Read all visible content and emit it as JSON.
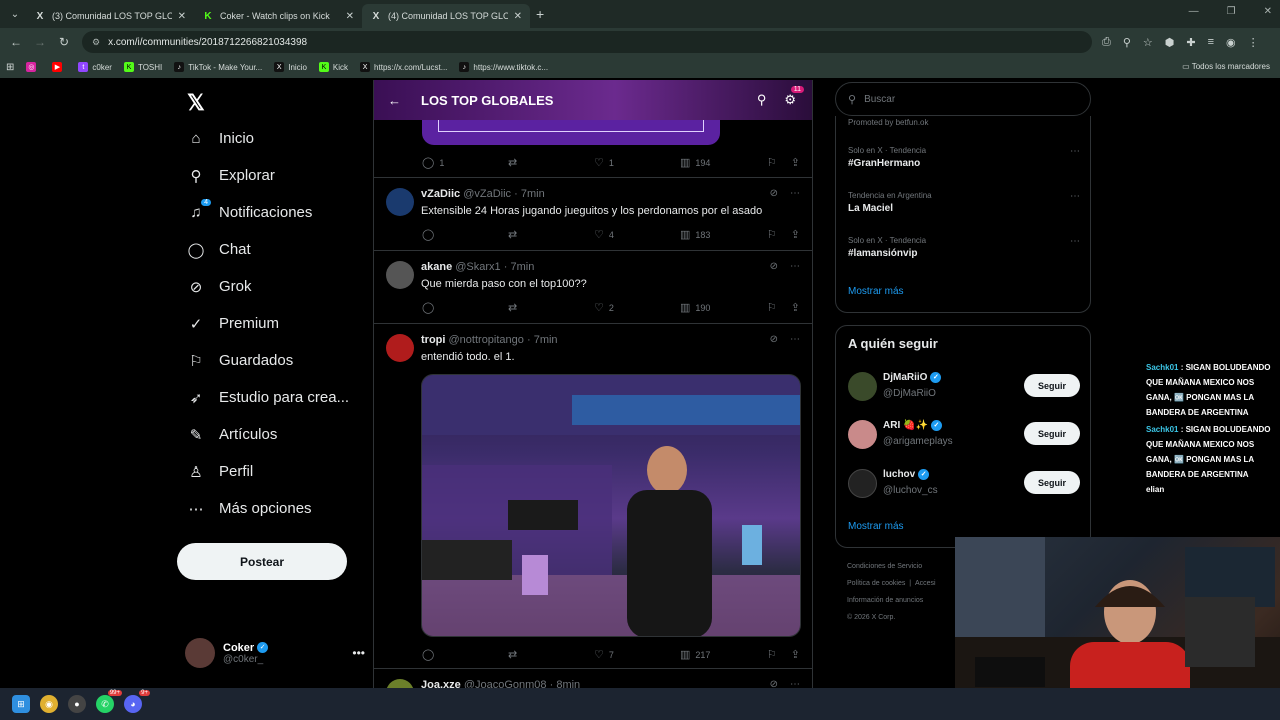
{
  "browser": {
    "tabs": [
      {
        "label": "(3) Comunidad LOS TOP GLOBALES",
        "icon": "x-logo-icon",
        "active": false
      },
      {
        "label": "Coker - Watch clips on Kick",
        "icon": "kick-icon",
        "active": false
      },
      {
        "label": "(4) Comunidad LOS TOP GLOBALES",
        "icon": "x-logo-icon",
        "active": true
      }
    ],
    "url": "x.com/i/communities/2018712266821034398",
    "bookmarks": [
      {
        "label": "",
        "icon": "instagram-icon",
        "color": "#d6249f"
      },
      {
        "label": "",
        "icon": "youtube-icon",
        "color": "#ff0000"
      },
      {
        "label": "c0ker",
        "icon": "twitch-icon",
        "color": "#9146ff"
      },
      {
        "label": "TOSHI",
        "icon": "kick-icon",
        "color": "#53fc18"
      },
      {
        "label": "TikTok - Make Your...",
        "icon": "tiktok-icon",
        "color": "#111111"
      },
      {
        "label": "Inicio",
        "icon": "x-logo-icon",
        "color": "#111111"
      },
      {
        "label": "Kick",
        "icon": "kick-icon",
        "color": "#53fc18"
      },
      {
        "label": "https://x.com/Lucst...",
        "icon": "x-logo-icon",
        "color": "#111111"
      },
      {
        "label": "https://www.tiktok.c...",
        "icon": "tiktok-icon",
        "color": "#111111"
      }
    ],
    "all_bookmarks": "Todos los marcadores"
  },
  "nav": {
    "items": [
      {
        "label": "Inicio",
        "icon": "home-icon",
        "glyph": "⌂"
      },
      {
        "label": "Explorar",
        "icon": "search-icon",
        "glyph": "⚲"
      },
      {
        "label": "Notificaciones",
        "icon": "bell-icon",
        "glyph": "🔔",
        "badge": "4"
      },
      {
        "label": "Chat",
        "icon": "chat-icon",
        "glyph": "◯"
      },
      {
        "label": "Grok",
        "icon": "grok-icon",
        "glyph": "⊘"
      },
      {
        "label": "Premium",
        "icon": "premium-icon",
        "glyph": "✓"
      },
      {
        "label": "Guardados",
        "icon": "bookmark-icon",
        "glyph": "⚐"
      },
      {
        "label": "Estudio para crea...",
        "icon": "rocket-icon",
        "glyph": "➶"
      },
      {
        "label": "Artículos",
        "icon": "article-icon",
        "glyph": "✎"
      },
      {
        "label": "Perfil",
        "icon": "profile-icon",
        "glyph": "♙"
      },
      {
        "label": "Más opciones",
        "icon": "more-icon",
        "glyph": "⋯"
      }
    ],
    "post_label": "Postear",
    "me": {
      "name": "Coker",
      "handle": "@c0ker_"
    }
  },
  "community": {
    "title": "LOS TOP GLOBALES",
    "settings_badge": "11"
  },
  "prev_tweet_actions": {
    "replies": "1",
    "likes": "1",
    "views": "194"
  },
  "tweets": [
    {
      "name": "vZaDiic",
      "handle": "@vZaDiic",
      "time": "7min",
      "text": "Extensible 24 Horas jugando jueguitos y los perdonamos por el asado",
      "replies": "",
      "likes": "4",
      "views": "183",
      "avatar_color": "#1a3a6e"
    },
    {
      "name": "akane",
      "handle": "@Skarx1",
      "time": "7min",
      "text": "Que mierda paso con el top100??",
      "replies": "",
      "likes": "2",
      "views": "190",
      "avatar_color": "#555555"
    },
    {
      "name": "tropi",
      "handle": "@nottropitango",
      "time": "7min",
      "text": "entendió todo. el 1.",
      "replies": "",
      "likes": "7",
      "views": "217",
      "avatar_color": "#b01c1c"
    },
    {
      "name": "Joa.xze",
      "handle": "@JoacoGonm08",
      "time": "8min",
      "text": "",
      "avatar_color": "#6b7f2a"
    }
  ],
  "search": {
    "placeholder": "Buscar"
  },
  "trends": {
    "promoted": "Promoted by betfun.ok",
    "items": [
      {
        "context": "Solo en X · Tendencia",
        "name": "#GranHermano"
      },
      {
        "context": "Tendencia en Argentina",
        "name": "La Maciel"
      },
      {
        "context": "Solo en X · Tendencia",
        "name": "#lamansiónvip"
      }
    ],
    "more": "Mostrar más"
  },
  "who_to_follow": {
    "title": "A quién seguir",
    "button": "Seguir",
    "items": [
      {
        "name": "DjMaRiiO",
        "handle": "@DjMaRiiO",
        "avatar_color": "#3a4a2a"
      },
      {
        "name": "ARI 🍓✨",
        "handle": "@arigameplays",
        "avatar_color": "#c98a8a"
      },
      {
        "name": "luchov",
        "handle": "@luchov_cs",
        "avatar_color": "#222222"
      }
    ],
    "more": "Mostrar más"
  },
  "footer": {
    "line1": "Condiciones de Servicio",
    "line2": "Política de cookies",
    "line2b": "Accesi",
    "line3": "Información de anuncios",
    "line4": "© 2026 X Corp."
  },
  "stream_chat": [
    {
      "user": "Sachk01",
      "msg": "SIGAN BOLUDEANDO QUE MAÑANA MEXICO NOS GANA, 🆗 PONGAN MAS LA BANDERA DE ARGENTINA"
    },
    {
      "user": "Sachk01",
      "msg": "SIGAN BOLUDEANDO QUE MAÑANA MEXICO NOS GANA, 🆗 PONGAN MAS LA BANDERA DE ARGENTINA"
    },
    {
      "user": "elian",
      "msg": ""
    }
  ],
  "taskbar": {
    "items": [
      {
        "icon": "windows-icon",
        "color": "#2f8fdf"
      },
      {
        "icon": "chrome-icon",
        "color": "#e0b030"
      },
      {
        "icon": "obs-icon",
        "color": "#444444"
      },
      {
        "icon": "whatsapp-icon",
        "color": "#25d366",
        "badge": "99+"
      },
      {
        "icon": "discord-icon",
        "color": "#5865f2",
        "badge": "9+"
      }
    ]
  }
}
